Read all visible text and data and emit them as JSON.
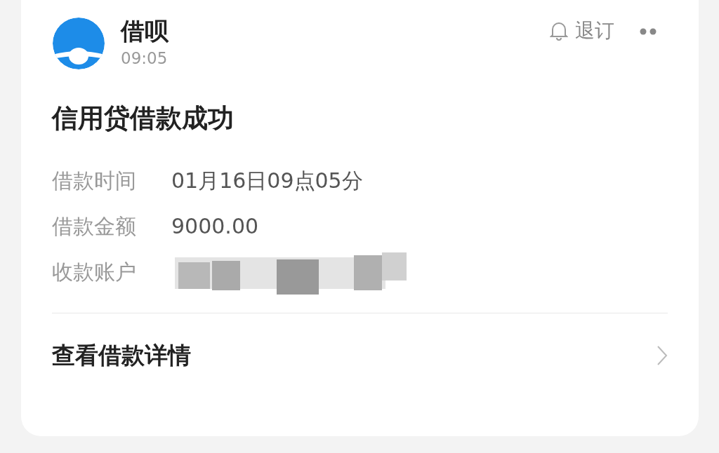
{
  "header": {
    "app_name": "借呗",
    "time": "09:05",
    "unsubscribe": "退订"
  },
  "title": "信用贷借款成功",
  "fields": [
    {
      "label": "借款时间",
      "kind": "text",
      "value": "01月16日09点05分"
    },
    {
      "label": "借款金额",
      "kind": "text",
      "value": "9000.00"
    },
    {
      "label": "收款账户",
      "kind": "redacted"
    }
  ],
  "footer_link": "查看借款详情"
}
